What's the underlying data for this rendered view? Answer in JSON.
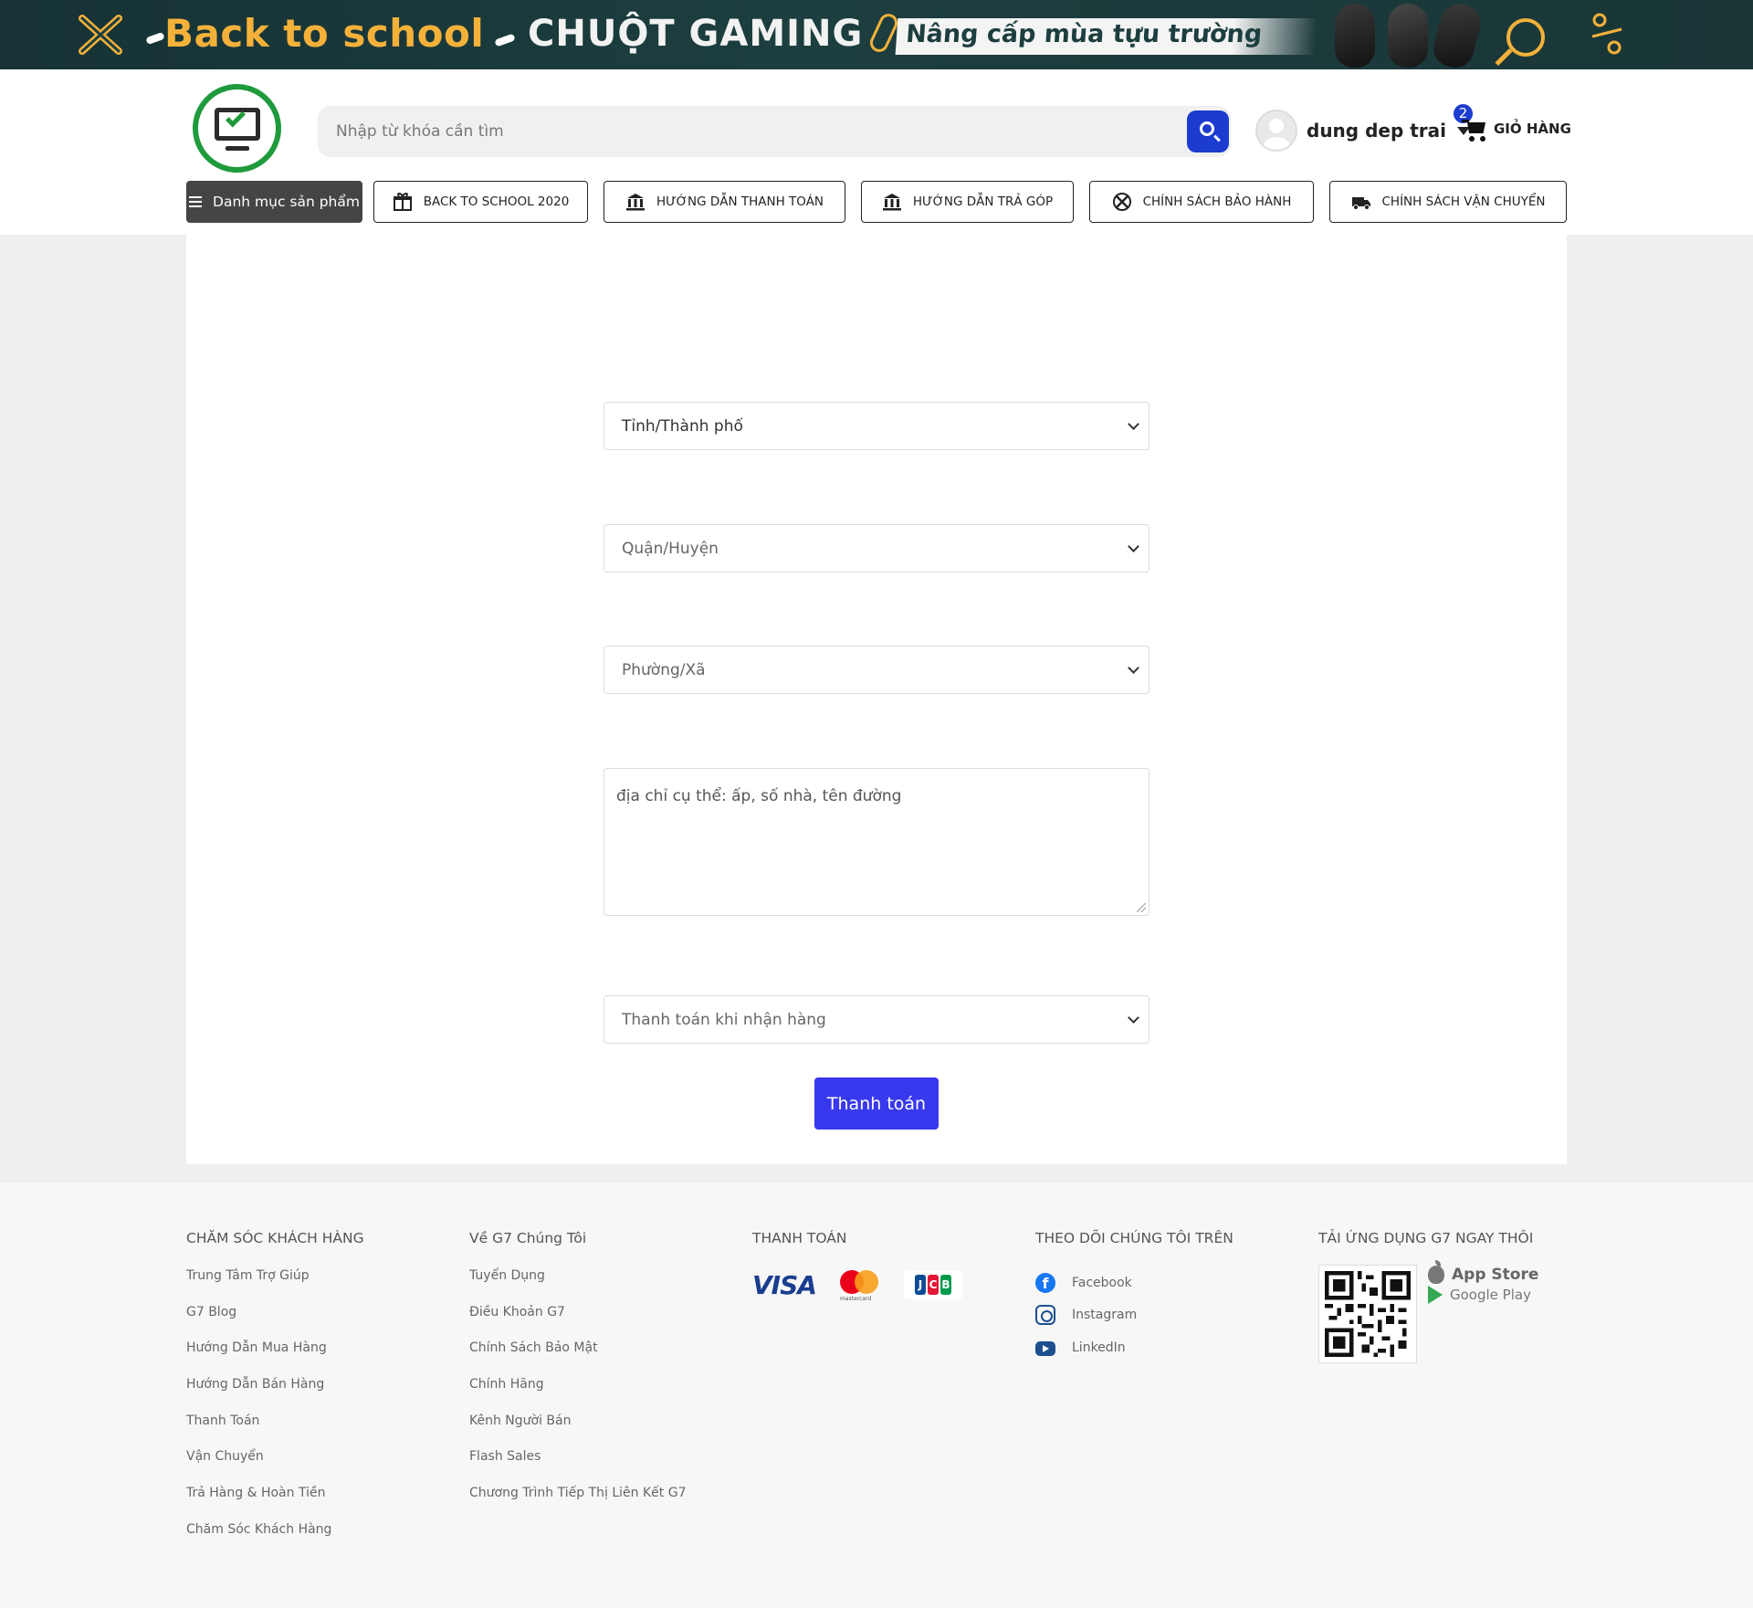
{
  "banner": {
    "text_back_to_school": "Back to school",
    "text_gaming": "CHUỘT GAMING",
    "text_upgrade": "Nâng cấp mùa tựu trường",
    "colors": {
      "background": "#1d3e3f",
      "accent": "#f4b13a"
    }
  },
  "header": {
    "search_placeholder": "Nhập từ khóa cần tìm",
    "user_name": "dung dep trai",
    "cart_count": "2",
    "cart_label": "GIỎ HÀNG",
    "colors": {
      "primary": "#1c3ccf",
      "logo_green": "#1f9a3c"
    }
  },
  "nav": {
    "category_label": "Danh mục sản phẩm",
    "items": [
      {
        "label": "BACK TO SCHOOL 2020",
        "icon": "gift-icon"
      },
      {
        "label": "HƯỚNG DẪN THANH TOÁN",
        "icon": "bank-icon"
      },
      {
        "label": "HƯỚNG DẪN TRẢ GÓP",
        "icon": "bank-icon"
      },
      {
        "label": "CHÍNH SÁCH BẢO HÀNH",
        "icon": "tools-icon"
      },
      {
        "label": "CHÍNH SÁCH VẬN CHUYỂN",
        "icon": "truck-icon"
      }
    ]
  },
  "form": {
    "province": "Tỉnh/Thành phố",
    "district": "Quận/Huyện",
    "ward": "Phường/Xã",
    "address_placeholder": "địa chỉ cụ thể: ấp, số nhà, tên đường",
    "payment_method": "Thanh toán khi nhận hàng",
    "submit_label": "Thanh toán",
    "colors": {
      "submit": "#3838ee"
    }
  },
  "footer": {
    "customer_care": {
      "title": "CHĂM SÓC KHÁCH HÀNG",
      "links": [
        "Trung Tâm Trợ Giúp",
        "G7 Blog",
        "Hướng Dẫn Mua Hàng",
        "Hướng Dẫn Bán Hàng",
        "Thanh Toán",
        "Vận Chuyển",
        "Trả Hàng & Hoàn Tiền",
        "Chăm Sóc Khách Hàng"
      ]
    },
    "about": {
      "title": "Về G7 Chúng Tôi",
      "links": [
        "Tuyển Dụng",
        "Điều Khoản G7",
        "Chính Sách Bảo Mật",
        "Chính Hãng",
        "Kênh Người Bán",
        "Flash Sales",
        "Chương Trình Tiếp Thị Liên Kết G7"
      ]
    },
    "payment": {
      "title": "THANH TOÁN",
      "visa": "VISA",
      "mastercard": "mastercard"
    },
    "social": {
      "title": "THEO DÕI CHÚNG TÔI TRÊN",
      "links": [
        "Facebook",
        "Instagram",
        "LinkedIn"
      ]
    },
    "app": {
      "title": "TẢI ỨNG DỤNG G7 NGAY THÔI",
      "app_store": "App Store",
      "google_play": "Google Play"
    }
  }
}
